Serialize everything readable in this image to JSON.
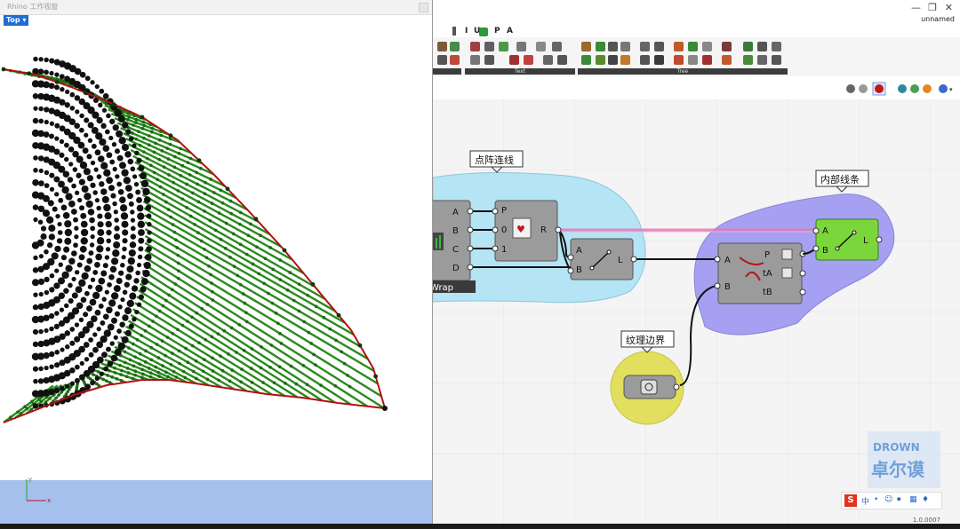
{
  "rhino": {
    "window_title": "Rhino 工作视窗",
    "viewport_label": "Top",
    "axis_y": "y",
    "axis_x": "x"
  },
  "grasshopper": {
    "tabs": [
      "I",
      "U",
      "P",
      "A"
    ],
    "ribbon_groups": [
      {
        "label": ""
      },
      {
        "label": "Text"
      },
      {
        "label": "Tree"
      }
    ],
    "document_name": "unnamed",
    "version": "1.0.0007",
    "groups": [
      {
        "label": "点阵连线",
        "color": "#b5e4f5"
      },
      {
        "label": "内部线条",
        "color": "#a6a0f2"
      },
      {
        "label": "纹理边界",
        "color": "#e2df5f"
      }
    ],
    "components": {
      "left_comp": {
        "inputs": [
          "A",
          "B",
          "C",
          "D"
        ],
        "footer": "Wrap"
      },
      "dispatch": {
        "inputs": [
          "P",
          "0",
          "1"
        ],
        "outputs": [
          "R"
        ]
      },
      "line1": {
        "inputs": [
          "A",
          "B"
        ],
        "outputs": [
          "L"
        ]
      },
      "intersect": {
        "inputs": [
          "A",
          "B"
        ],
        "outputs": [
          "P",
          "tA",
          "tB"
        ]
      },
      "line2": {
        "inputs": [
          "A",
          "B"
        ],
        "outputs": [
          "L"
        ]
      }
    },
    "watermark": {
      "line1": "DROWN",
      "line2": "卓尔谟"
    }
  },
  "colors": {
    "curve": "#b01010",
    "lines": "#2a8a1e",
    "dots": "#111111",
    "viewport_label": "#1e6cd6",
    "ground": "#a6c0ee"
  }
}
